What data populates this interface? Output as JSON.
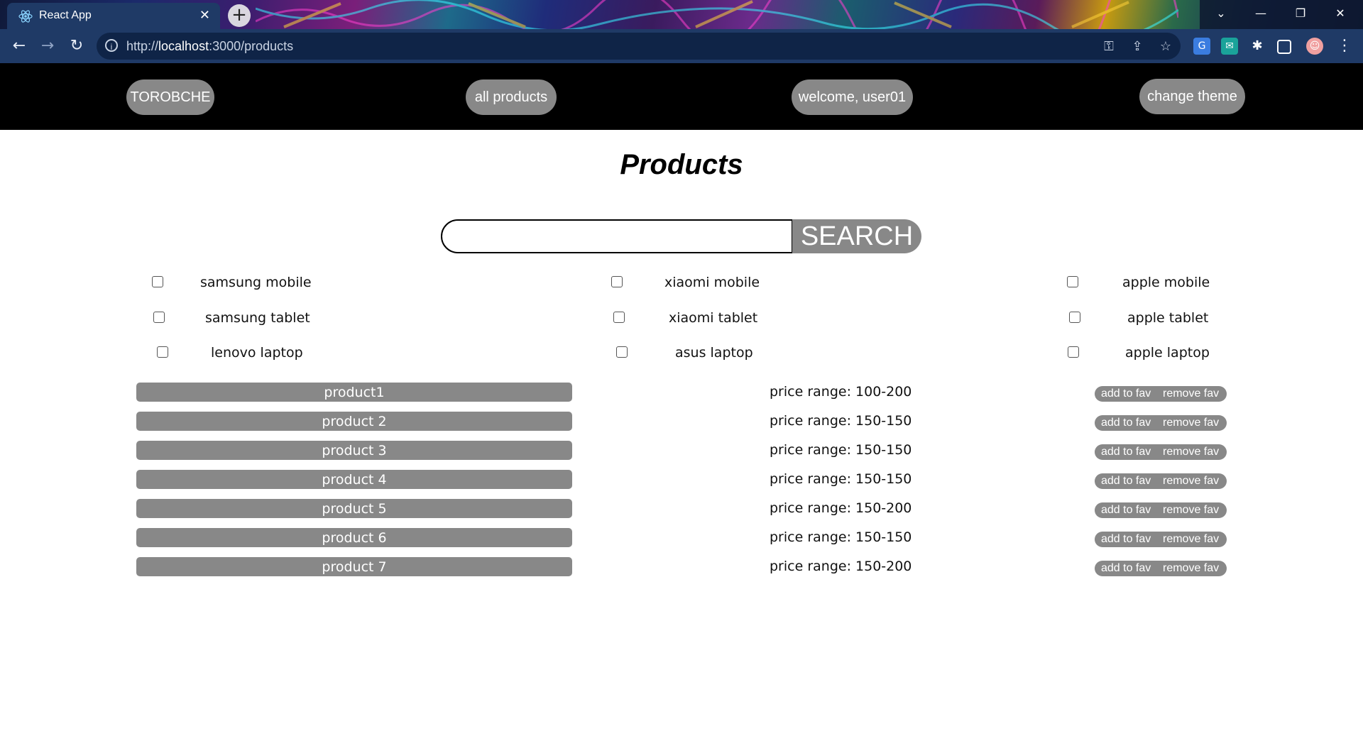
{
  "browser": {
    "tab_title": "React App",
    "tab_close": "✕",
    "new_tab": "+",
    "url_prefix": "http://",
    "url_host": "localhost",
    "url_rest": ":3000/products",
    "window_controls": {
      "menu": "⌄",
      "minimize": "—",
      "restore": "❐",
      "close": "✕"
    }
  },
  "nav": {
    "brand": "TOROBCHE",
    "all_products": "all products",
    "welcome": "welcome, user01",
    "change_theme": "change theme"
  },
  "page_title": "Products",
  "search": {
    "value": "",
    "placeholder": "",
    "button": "SEARCH"
  },
  "filters": [
    [
      "samsung mobile",
      "xiaomi mobile",
      "apple mobile"
    ],
    [
      "samsung tablet",
      "xiaomi tablet",
      "apple tablet"
    ],
    [
      "lenovo laptop",
      "asus laptop",
      "apple laptop"
    ]
  ],
  "products": [
    {
      "name": "product1",
      "price": "price range: 100-200"
    },
    {
      "name": "product 2",
      "price": "price range: 150-150"
    },
    {
      "name": "product 3",
      "price": "price range: 150-150"
    },
    {
      "name": "product 4",
      "price": "price range: 150-150"
    },
    {
      "name": "product 5",
      "price": "price range: 150-200"
    },
    {
      "name": "product 6",
      "price": "price range: 150-150"
    },
    {
      "name": "product 7",
      "price": "price range: 150-200"
    }
  ],
  "fav": {
    "add": "add to fav",
    "remove": "remove fav"
  },
  "colors": {
    "pill_gray": "#888888",
    "nav_black": "#000000",
    "toolbar": "#1f3a66"
  }
}
